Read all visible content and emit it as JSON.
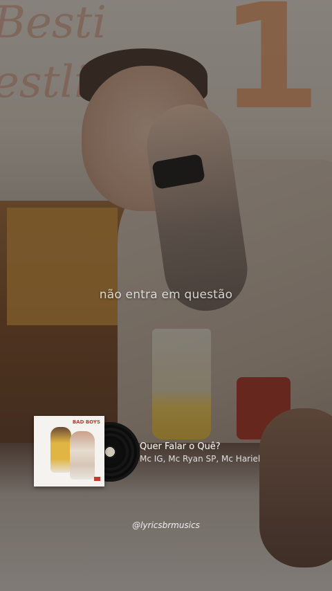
{
  "lyric": {
    "line": "não entra em questão"
  },
  "song": {
    "title": "Quer Falar o Quê?",
    "artists": "Mc IG, Mc Ryan SP, Mc Hariel",
    "cover_label": "BAD BOYS",
    "cover_icon": "album-cover-icon"
  },
  "watermark": {
    "handle": "@lyricsbrmusics"
  },
  "colors": {
    "overlay": "#14100e",
    "text": "#ffffff",
    "cover_accent": "#c63a2c"
  }
}
